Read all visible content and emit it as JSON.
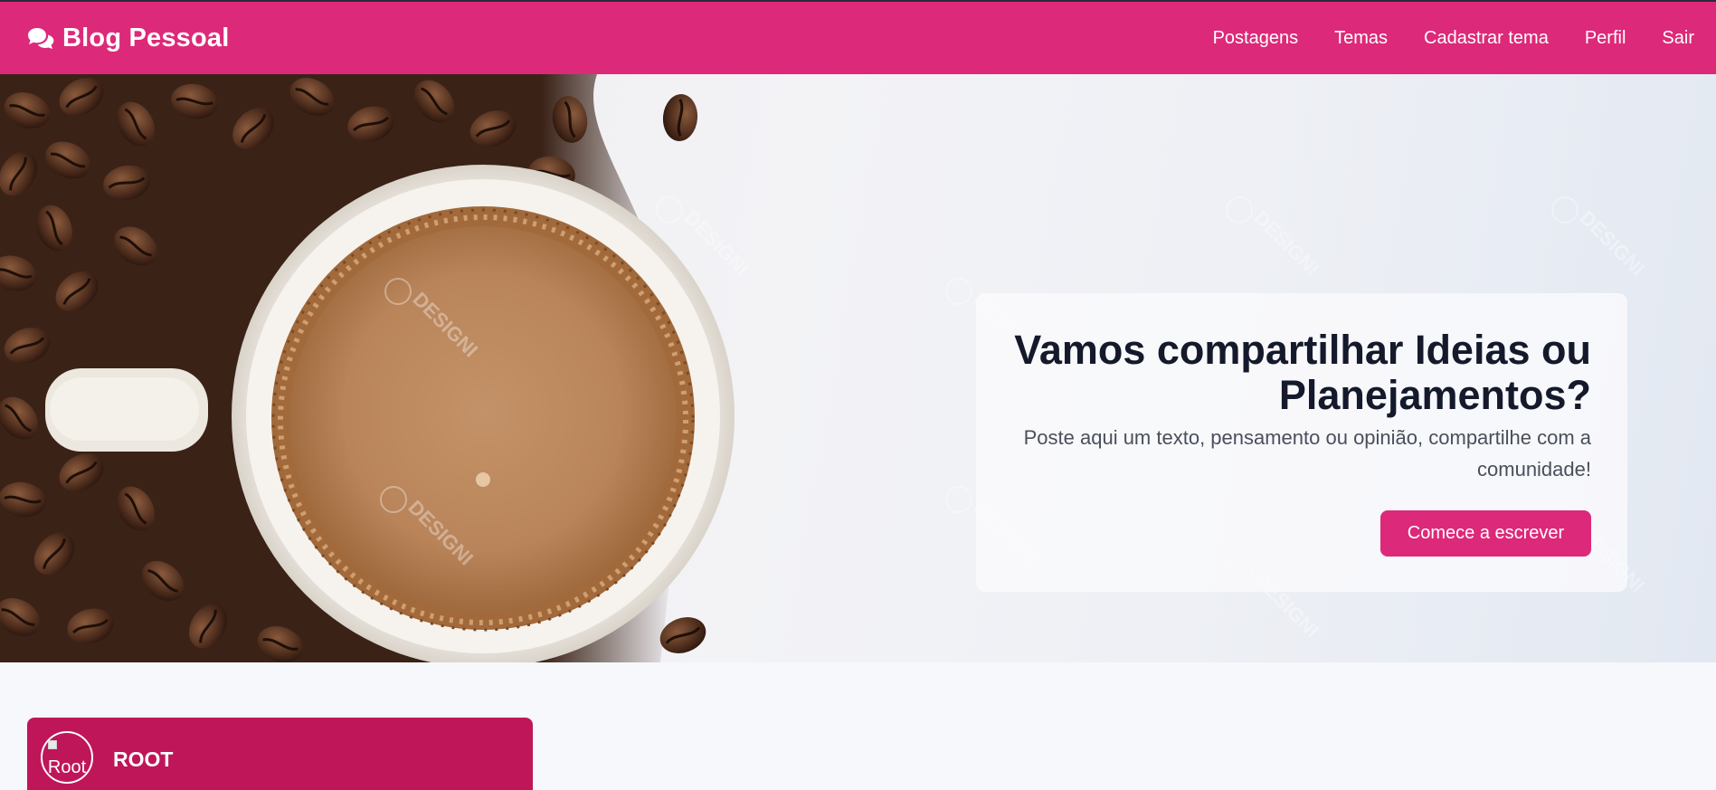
{
  "app": {
    "brand": "Blog Pessoal",
    "brand_icon": "comments-icon"
  },
  "nav": {
    "links": [
      "Postagens",
      "Temas",
      "Cadastrar tema",
      "Perfil",
      "Sair"
    ]
  },
  "hero": {
    "title": "Vamos compartilhar Ideias ou Planejamentos?",
    "subtitle": "Poste aqui um texto, pensamento ou opinião, compartilhe com a comunidade!",
    "cta_label": "Comece a escrever",
    "watermark": "DESIGNI"
  },
  "post": {
    "avatar_alt": "Root",
    "username": "ROOT"
  },
  "colors": {
    "brand": "#dd2979",
    "post_header": "#bf1659",
    "title_text": "#141a2b"
  }
}
